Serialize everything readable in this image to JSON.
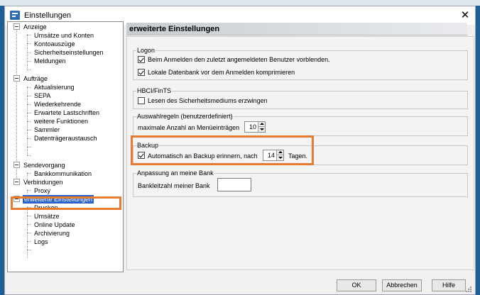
{
  "window": {
    "title": "Einstellungen",
    "close_glyph": "✕"
  },
  "tree": {
    "items": [
      {
        "label": "Anzeige"
      },
      {
        "label": "Umsätze und Konten"
      },
      {
        "label": "Kontoauszüge"
      },
      {
        "label": "Sicherheitseinstellungen"
      },
      {
        "label": "Meldungen"
      },
      {
        "label": "Aufträge"
      },
      {
        "label": "Aktualisierung"
      },
      {
        "label": "SEPA"
      },
      {
        "label": "Wiederkehrende"
      },
      {
        "label": "Erwartete Lastschriften"
      },
      {
        "label": "weitere Funktionen"
      },
      {
        "label": "Sammler"
      },
      {
        "label": "Datenträgeraustausch"
      },
      {
        "label": "Sendevorgang"
      },
      {
        "label": "Bankkommunikation"
      },
      {
        "label": "Verbindungen"
      },
      {
        "label": "Proxy"
      },
      {
        "label": "erweiterte Einstellungen",
        "selected": true
      },
      {
        "label": "Drucken"
      },
      {
        "label": "Umsätze"
      },
      {
        "label": "Online Update"
      },
      {
        "label": "Archivierung"
      },
      {
        "label": "Logs"
      }
    ]
  },
  "panel": {
    "title": "erweiterte Einstellungen",
    "logon": {
      "title": "Logon",
      "opt1": "Beim Anmelden den zuletzt angemeldeten Benutzer vorblenden.",
      "opt1_checked": true,
      "opt2": "Lokale Datenbank vor dem Anmelden komprimieren",
      "opt2_checked": true
    },
    "hbci": {
      "title": "HBCI/FinTS",
      "opt1": "Lesen des Sicherheitsmediums erzwingen",
      "opt1_checked": false
    },
    "auswahl": {
      "title": "Auswahlregeln (benutzerdefiniert)",
      "label": "maximale Anzahl an Menüeinträgen",
      "value": "10"
    },
    "backup": {
      "title": "Backup",
      "label_before": "Automatisch an Backup erinnern, nach",
      "checked": true,
      "value": "14",
      "label_after": "Tagen."
    },
    "bank": {
      "title": "Anpassung an meine Bank",
      "label": "Bankleitzahl meiner Bank",
      "value": ""
    }
  },
  "buttons": {
    "ok": "OK",
    "cancel": "Abbrechen",
    "help": "Hilfe"
  },
  "highlight_color": "#ea7b2e"
}
